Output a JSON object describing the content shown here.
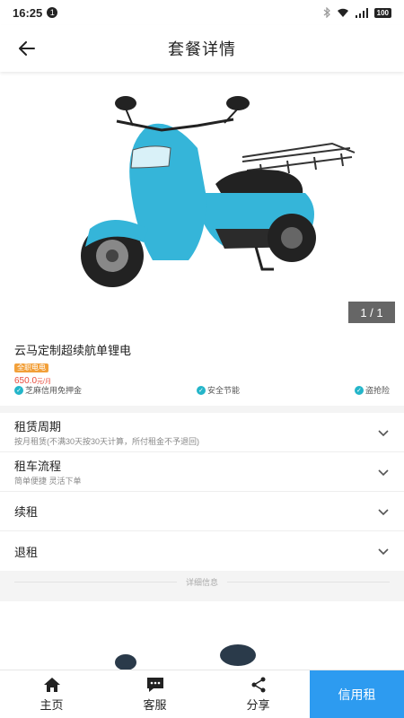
{
  "status_bar": {
    "time": "16:25",
    "notification_count": "1",
    "battery": "100"
  },
  "header": {
    "title": "套餐详情"
  },
  "gallery": {
    "indicator": "1 / 1",
    "scooter_color": "#35b5d9"
  },
  "product": {
    "name": "云马定制超续航单锂电",
    "tag": "全职电电",
    "price": "650.0",
    "price_unit": "元/月",
    "features": [
      "芝麻信用免押金",
      "安全节能",
      "盗抢险"
    ]
  },
  "accordion": [
    {
      "title": "租赁周期",
      "subtitle": "按月租赁(不满30天按30天计算，所付租金不予退回)"
    },
    {
      "title": "租车流程",
      "subtitle": "简单便捷 灵活下单"
    },
    {
      "title": "续租",
      "subtitle": ""
    },
    {
      "title": "退租",
      "subtitle": ""
    }
  ],
  "detail_divider": "详细信息",
  "bottom_nav": {
    "home": "主页",
    "service": "客服",
    "share": "分享",
    "rent": "信用租"
  },
  "colors": {
    "accent": "#2d9bf0",
    "price": "#e84b3c",
    "tag": "#f2a03a",
    "check": "#24b5c9"
  }
}
